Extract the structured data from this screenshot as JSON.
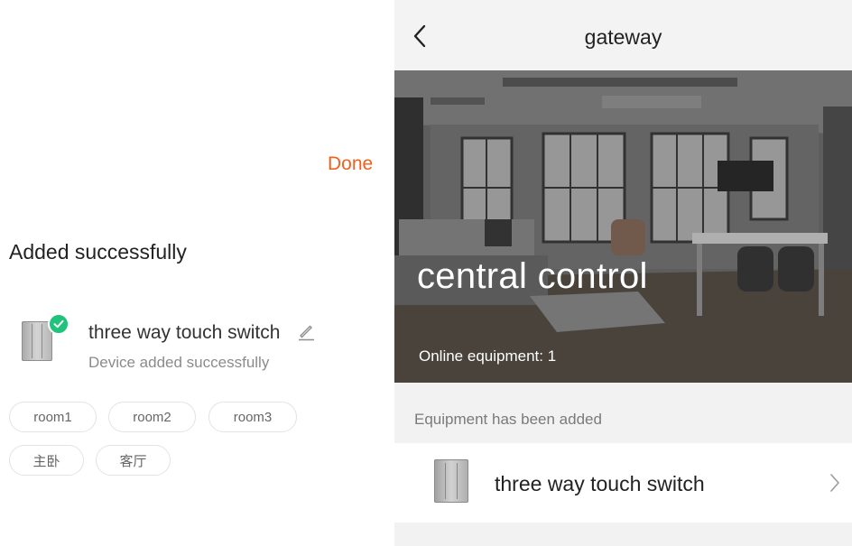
{
  "left": {
    "done_label": "Done",
    "title": "Added successfully",
    "device": {
      "icon": "three-gang-switch-icon",
      "badge_icon": "check-icon",
      "name": "three way touch switch",
      "status": "Device added successfully",
      "edit_icon": "pencil-icon"
    },
    "rooms": [
      "room1",
      "room2",
      "room3",
      "主卧",
      "客厅"
    ]
  },
  "right": {
    "back_icon": "chevron-left-icon",
    "title": "gateway",
    "hero": {
      "title": "central control",
      "subtitle": "Online equipment: 1"
    },
    "section_label": "Equipment has been added",
    "device_row": {
      "icon": "three-gang-switch-icon",
      "name": "three way touch switch",
      "chevron_icon": "chevron-right-icon"
    }
  },
  "colors": {
    "accent": "#f0601e",
    "success": "#1fc37c",
    "background": "#f2f2f2"
  }
}
